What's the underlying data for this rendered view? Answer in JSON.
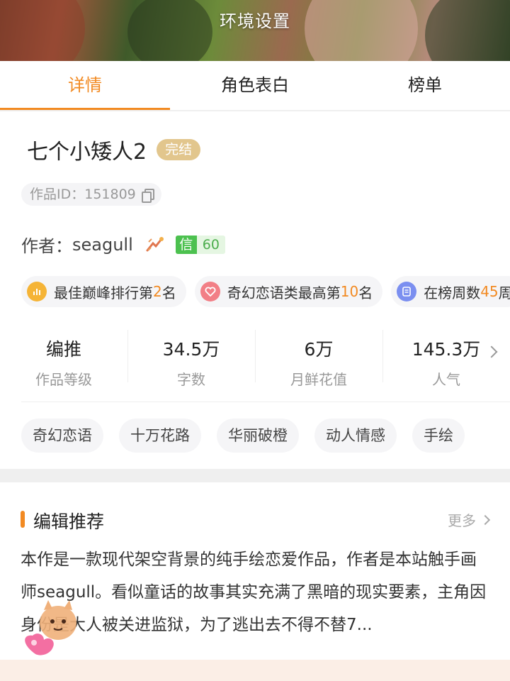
{
  "hero": {
    "title": "环境设置"
  },
  "tabs": [
    {
      "label": "详情",
      "active": true
    },
    {
      "label": "角色表白",
      "active": false
    },
    {
      "label": "榜单",
      "active": false
    }
  ],
  "work": {
    "title": "七个小矮人2",
    "status_badge": "完结",
    "id_text": "作品ID：151809",
    "author_label": "作者：",
    "author_name": "seagull",
    "credit_label": "信",
    "credit_value": "60"
  },
  "ranks": [
    {
      "prefix": "最佳巅峰排行第",
      "num": "2",
      "suffix": "名",
      "icon": "bar-chart-icon",
      "color": "#f5b437"
    },
    {
      "prefix": "奇幻恋语类最高第",
      "num": "10",
      "suffix": "名",
      "icon": "heart-icon",
      "color": "#f27f86"
    },
    {
      "prefix": "在榜周数",
      "num": "45",
      "suffix": "周",
      "icon": "document-icon",
      "color": "#7b8ff0"
    }
  ],
  "stats": [
    {
      "value": "编推",
      "label": "作品等级"
    },
    {
      "value": "34.5万",
      "label": "字数"
    },
    {
      "value": "6万",
      "label": "月鲜花值"
    },
    {
      "value": "145.3万",
      "label": "人气"
    }
  ],
  "tags": [
    "奇幻恋语",
    "十万花路",
    "华丽破橙",
    "动人情感",
    "手绘"
  ],
  "recommend": {
    "title": "编辑推荐",
    "more": "更多",
    "text": "本作是一款现代架空背景的纯手绘恋爱作品，作者是本站触手画师seagull。看似童话的故事其实充满了黑暗的现实要素，主角因身份是大人被关进监狱，为了逃出去不得不替7..."
  },
  "colors": {
    "accent": "#f28a22",
    "badge": "#e2c68d",
    "credit_green": "#4cc14f"
  }
}
